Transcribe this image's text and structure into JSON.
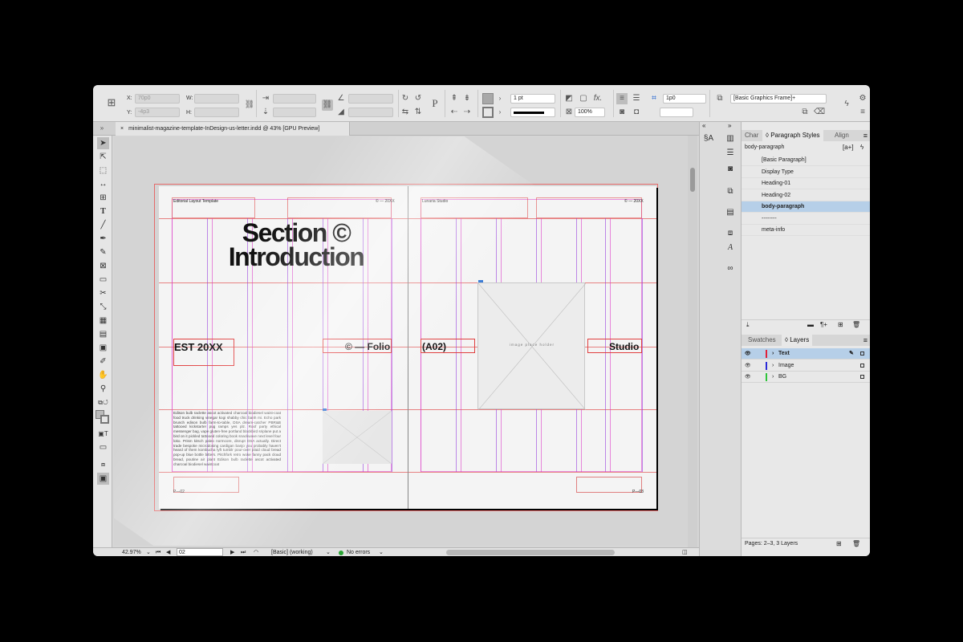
{
  "control_panel": {
    "x_label": "X:",
    "x_value": "70p0",
    "y_label": "Y:",
    "y_value": "-4p3",
    "w_label": "W:",
    "h_label": "H:",
    "stroke_weight": "1 pt",
    "opacity": "100%",
    "offset_value": "1p0",
    "object_style": "[Basic Graphics Frame]+"
  },
  "document_tab": {
    "title": "minimalist-magazine-template-InDesign-us-letter.indd @ 43% [GPU Preview]"
  },
  "spread": {
    "left_page": {
      "header_left": "Editorial Layout Template",
      "header_right": "© — 20XX",
      "headline_line1": "Section ©",
      "headline_line2": "Introduction",
      "label_est": "EST 20XX",
      "label_folio": "© — Folio",
      "body_text": "Edison bulb raclette ascot activated charcoal biodiesel waist-coat food truck drinking vinegar kogi shabby chic banh mi. Echo park brunch edison bulb farm-to-table, DSA dream-catcher PBR&B tattooed kickstarter pug ramps yes plz. Roof party ethical messenger bag, vape gluten-free portland blackbird sriplane put a bird on it pickled tattooed coloring book snackwave next level four loko. Prism kitsch paleo normcore, disrupt DSA actually. Direct trade bespoke microdosing cardigan banjo you probably haven't heard of them kombucha lyft tumblr pour-over plaid cloud bread pop-up blue bottle bitters. Pitchfork retro woke fanny pack cloud bread, poutine air plant Edison bulb raclette ascot activated charcoal biodiesel waistcoat",
      "folio": "P—02"
    },
    "right_page": {
      "header_left": "Lunaria Studio",
      "header_right": "© — 20XX",
      "label_a02": "(A02)",
      "label_studio": "Studio",
      "image_placeholder": "image place holder",
      "folio": "P—03"
    }
  },
  "status_bar": {
    "zoom": "42.97%",
    "page": "02",
    "profile": "[Basic] (working)",
    "preflight": "No errors"
  },
  "paragraph_panel": {
    "tabs": [
      "Char",
      "Paragraph Styles",
      "Align"
    ],
    "current_style": "body-paragraph",
    "styles": [
      "[Basic Paragraph]",
      "Display Type",
      "Heading-01",
      "Heading-02",
      "body-paragraph",
      "--------",
      "meta-info"
    ],
    "selected_style": "body-paragraph"
  },
  "layers_panel": {
    "tabs": [
      "Swatches",
      "Layers"
    ],
    "layers": [
      {
        "name": "Text",
        "color": "#e0203a"
      },
      {
        "name": "Image",
        "color": "#2a2ad8"
      },
      {
        "name": "BG",
        "color": "#2ec43a"
      }
    ],
    "footer": "Pages: 2–3, 3 Layers"
  }
}
